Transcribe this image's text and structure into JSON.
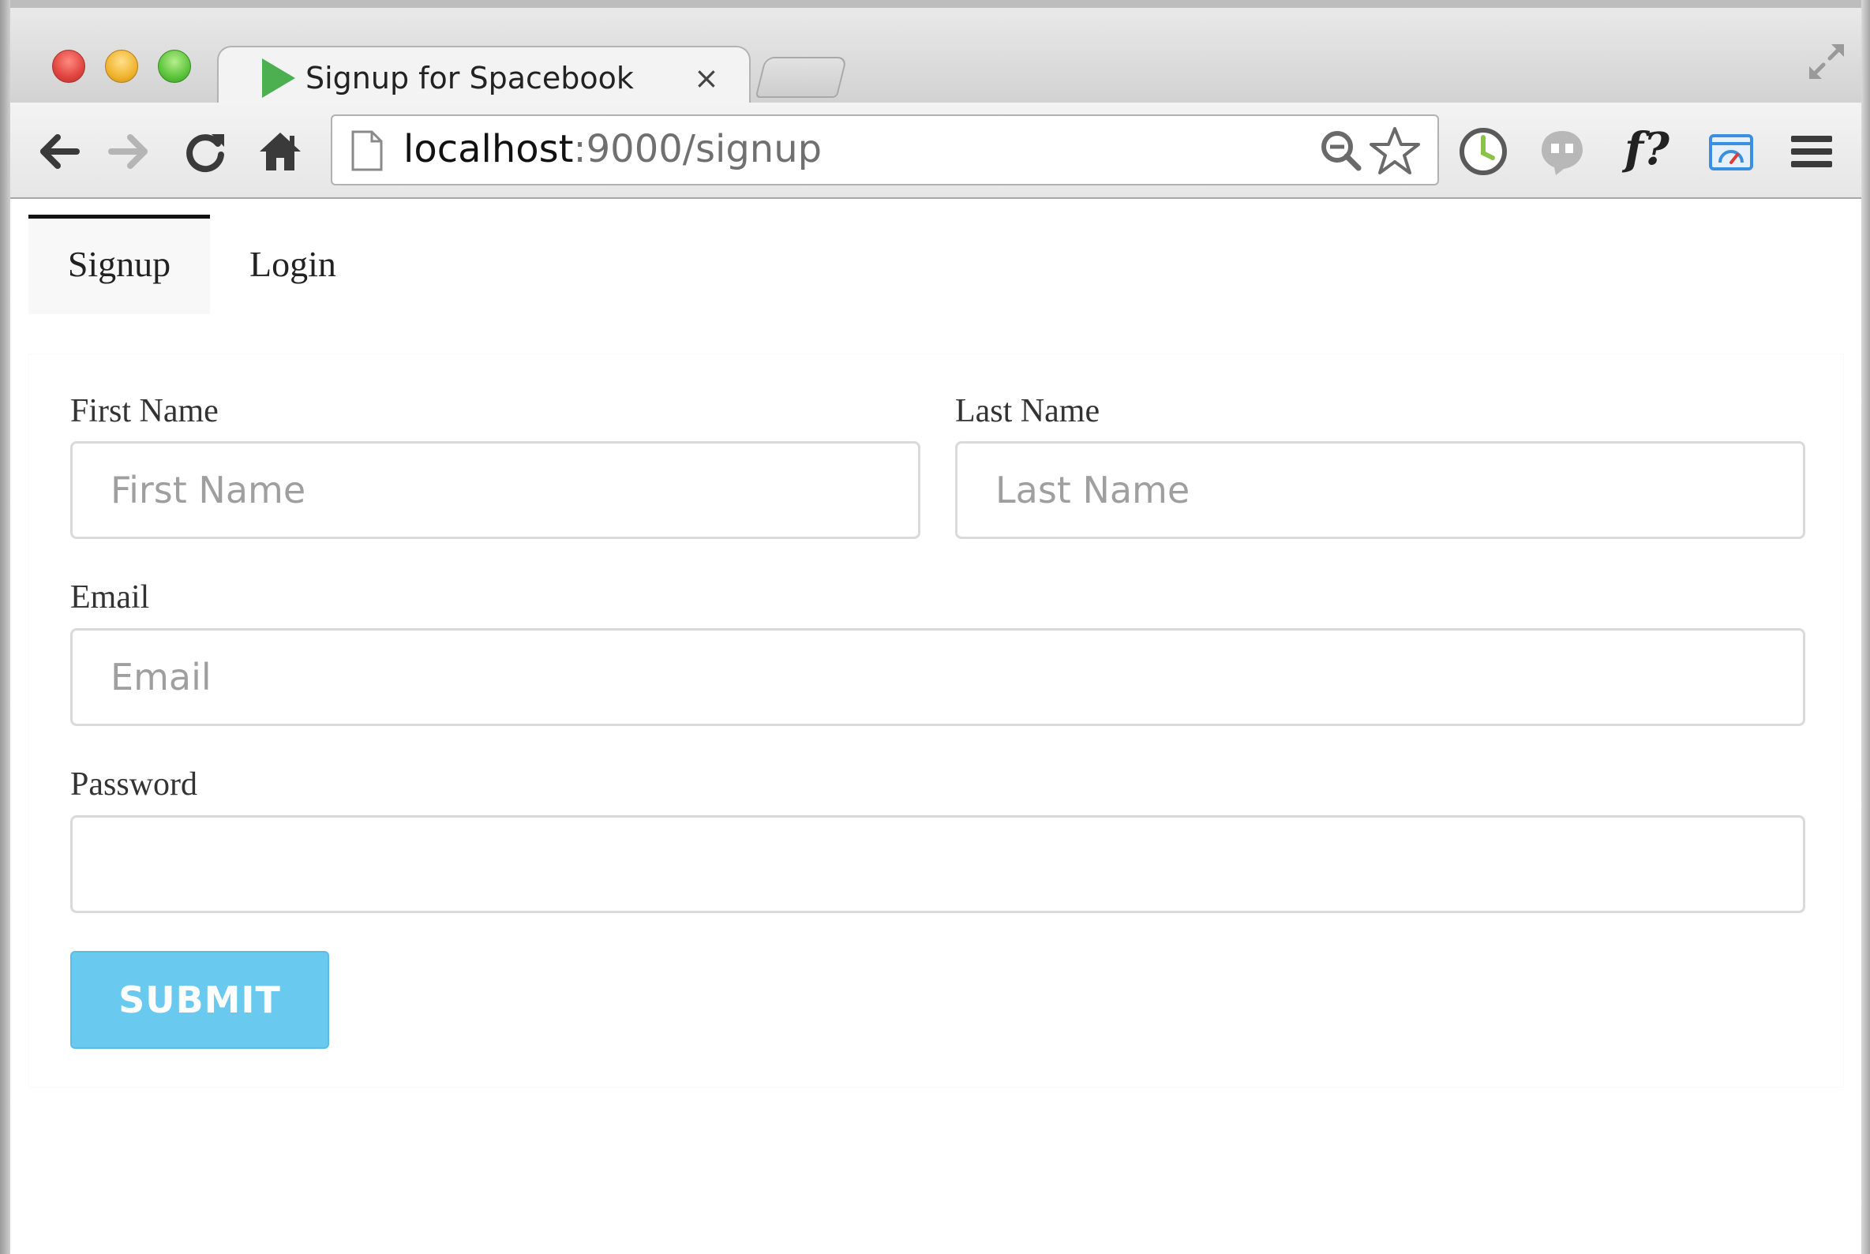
{
  "browser": {
    "tab": {
      "title": "Signup for Spacebook",
      "close_glyph": "×",
      "favicon": "play-triangle-icon"
    },
    "address_bar": {
      "host": "localhost",
      "path": ":9000/signup"
    },
    "toolbar_icons": [
      "back-arrow-icon",
      "forward-arrow-icon",
      "reload-icon",
      "home-icon",
      "page-icon",
      "zoom-out-icon",
      "star-icon",
      "clock-extension-icon",
      "quote-extension-icon",
      "font-finder-icon",
      "speed-extension-icon",
      "menu-icon"
    ],
    "font_finder_label": "f?"
  },
  "nav": {
    "tabs": [
      {
        "label": "Signup",
        "active": true
      },
      {
        "label": "Login",
        "active": false
      }
    ]
  },
  "form": {
    "first_name": {
      "label": "First Name",
      "placeholder": "First Name",
      "value": ""
    },
    "last_name": {
      "label": "Last Name",
      "placeholder": "Last Name",
      "value": ""
    },
    "email": {
      "label": "Email",
      "placeholder": "Email",
      "value": ""
    },
    "password": {
      "label": "Password",
      "placeholder": "",
      "value": ""
    },
    "submit_label": "SUBMIT"
  },
  "colors": {
    "submit_bg": "#6ac9ef",
    "active_tab_border": "#111111",
    "favicon_green": "#4caf50",
    "clock_green": "#8bc34a",
    "speed_blue": "#3b8fe0"
  }
}
